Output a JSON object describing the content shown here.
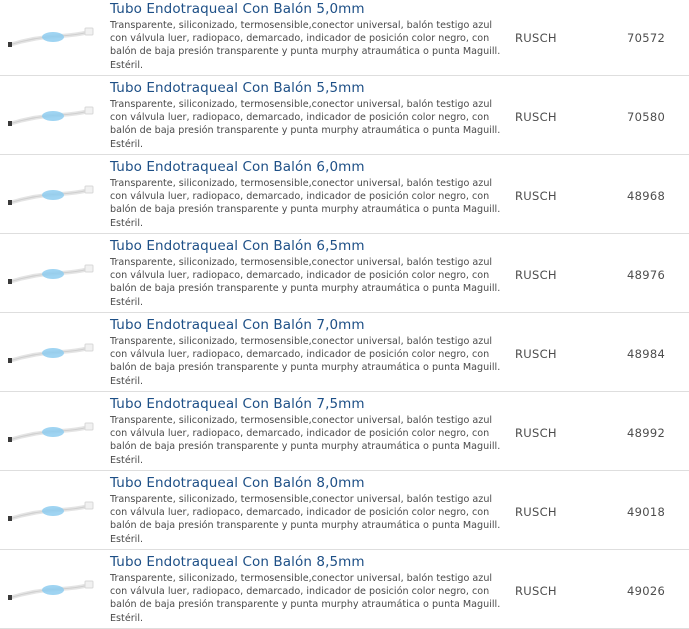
{
  "products": [
    {
      "title": "Tubo Endotraqueal Con Balón 5,0mm",
      "description": "Transparente, siliconizado, termosensible,conector universal, balón testigo azul con válvula luer, radiopaco, demarcado, indicador de posición color negro, con balón de baja presión transparente y punta murphy atraumática o punta Maguill. Estéril.",
      "brand": "RUSCH",
      "code": "70572"
    },
    {
      "title": "Tubo Endotraqueal Con Balón 5,5mm",
      "description": "Transparente, siliconizado, termosensible,conector universal, balón testigo azul con válvula luer, radiopaco, demarcado, indicador de posición color negro, con balón de baja presión transparente y punta murphy atraumática o punta Maguill. Estéril.",
      "brand": "RUSCH",
      "code": "70580"
    },
    {
      "title": "Tubo Endotraqueal Con Balón 6,0mm",
      "description": "Transparente, siliconizado, termosensible,conector universal, balón testigo azul con válvula luer, radiopaco, demarcado, indicador de posición color negro, con balón de baja presión transparente y punta murphy atraumática o punta Maguill. Estéril.",
      "brand": "RUSCH",
      "code": "48968"
    },
    {
      "title": "Tubo Endotraqueal Con Balón 6,5mm",
      "description": "Transparente, siliconizado, termosensible,conector universal, balón testigo azul con válvula luer, radiopaco, demarcado, indicador de posición color negro, con balón de baja presión transparente y punta murphy atraumática o punta Maguill. Estéril.",
      "brand": "RUSCH",
      "code": "48976"
    },
    {
      "title": "Tubo Endotraqueal Con Balón 7,0mm",
      "description": "Transparente, siliconizado, termosensible,conector universal, balón testigo azul con válvula luer, radiopaco, demarcado, indicador de posición color negro, con balón de baja presión transparente y punta murphy atraumática o punta Maguill. Estéril.",
      "brand": "RUSCH",
      "code": "48984"
    },
    {
      "title": "Tubo Endotraqueal Con Balón 7,5mm",
      "description": "Transparente, siliconizado, termosensible,conector universal, balón testigo azul con válvula luer, radiopaco, demarcado, indicador de posición color negro, con balón de baja presión transparente y punta murphy atraumática o punta Maguill. Estéril.",
      "brand": "RUSCH",
      "code": "48992"
    },
    {
      "title": "Tubo Endotraqueal Con Balón 8,0mm",
      "description": "Transparente, siliconizado, termosensible,conector universal, balón testigo azul con válvula luer, radiopaco, demarcado, indicador de posición color negro, con balón de baja presión transparente y punta murphy atraumática o punta Maguill. Estéril.",
      "brand": "RUSCH",
      "code": "49018"
    },
    {
      "title": "Tubo Endotraqueal Con Balón 8,5mm",
      "description": "Transparente, siliconizado, termosensible,conector universal, balón testigo azul con válvula luer, radiopaco, demarcado, indicador de posición color negro, con balón de baja presión transparente y punta murphy atraumática o punta Maguill. Estéril.",
      "brand": "RUSCH",
      "code": "49026"
    }
  ],
  "colors": {
    "title": "#1d4f86",
    "text": "#4a4a4a",
    "divider": "#dedede",
    "balloon": "#8ecdf0"
  },
  "icons": {
    "thumbnail": "endotracheal-tube-icon"
  }
}
